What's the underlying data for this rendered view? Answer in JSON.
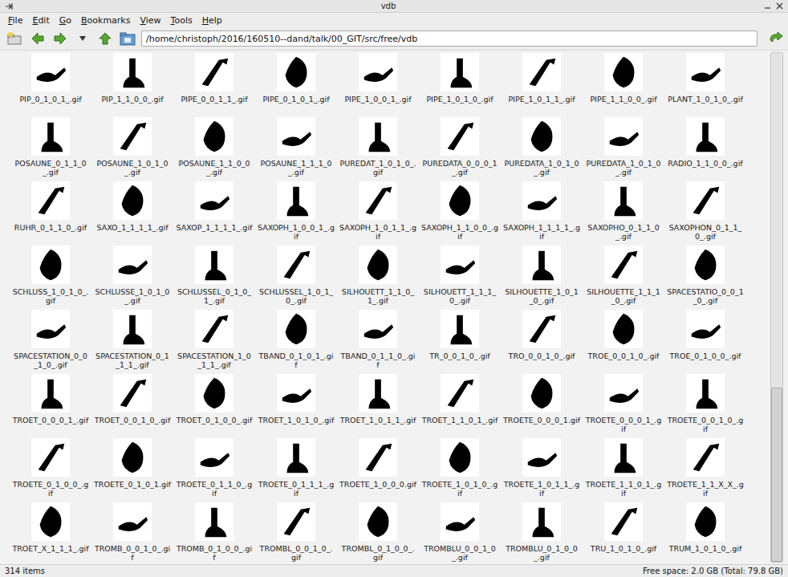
{
  "window": {
    "title": "vdb"
  },
  "menu": [
    "File",
    "Edit",
    "Go",
    "Bookmarks",
    "View",
    "Tools",
    "Help"
  ],
  "toolbar": {
    "path": "/home/christoph/2016/160510--dand/talk/00_GIT/src/free/vdb"
  },
  "files": [
    {
      "name": "PIP_0_1_0_1_.gif"
    },
    {
      "name": "PIP_1_1_0_0_.gif"
    },
    {
      "name": "PIPE_0_0_1_1_.gif"
    },
    {
      "name": "PIPE_0_1_0_1_.gif"
    },
    {
      "name": "PIPE_1_0_0_1_.gif"
    },
    {
      "name": "PIPE_1_0_1_0_.gif"
    },
    {
      "name": "PIPE_1_0_1_1_.gif"
    },
    {
      "name": "PIPE_1_1_0_0_.gif"
    },
    {
      "name": "PLANT_1_0_1_0_.gif"
    },
    {
      "name": "POSAUNE_0_1_1_0_.gif"
    },
    {
      "name": "POSAUNE_1_0_1_0_.gif"
    },
    {
      "name": "POSAUNE_1_1_0_0_.gif"
    },
    {
      "name": "POSAUNE_1_1_1_0_.gif"
    },
    {
      "name": "PUREDAT_1_0_1_0_.gif"
    },
    {
      "name": "PUREDATA_0_0_0_1_.gif"
    },
    {
      "name": "PUREDATA_1_0_1_0_.gif"
    },
    {
      "name": "PUREDATA_1_0_1_0_.gif"
    },
    {
      "name": "RADIO_1_1_0_0_.gif"
    },
    {
      "name": "RUHR_0_1_1_0_.gif"
    },
    {
      "name": "SAXO_1_1_1_1_.gif"
    },
    {
      "name": "SAXOP_1_1_1_1_.gif"
    },
    {
      "name": "SAXOPH_1_0_0_1_.gif"
    },
    {
      "name": "SAXOPH_1_0_1_1_.gif"
    },
    {
      "name": "SAXOPH_1_1_0_0_.gif"
    },
    {
      "name": "SAXOPH_1_1_1_1_.gif"
    },
    {
      "name": "SAXOPHO_0_1_1_0_.gif"
    },
    {
      "name": "SAXOPHON_0_1_1_0_.gif"
    },
    {
      "name": "SCHLUSS_1_0_1_0_.gif"
    },
    {
      "name": "SCHLUSSE_1_0_1_0_.gif"
    },
    {
      "name": "SCHLUSSEL_0_1_0_1_.gif"
    },
    {
      "name": "SCHLUSSEL_1_0_1_0_.gif"
    },
    {
      "name": "SILHOUETT_1_1_0_1_.gif"
    },
    {
      "name": "SILHOUETT_1_1_1_0_.gif"
    },
    {
      "name": "SILHOUETTE_1_0_1_0_.gif"
    },
    {
      "name": "SILHOUETTE_1_1_1_0_.gif"
    },
    {
      "name": "SPACESTATIO_0_0_1_0_.gif"
    },
    {
      "name": "SPACESTATION_0_0_1_0_.gif"
    },
    {
      "name": "SPACESTATION_0_1_1_1_.gif"
    },
    {
      "name": "SPACESTATION_1_0_1_1_.gif"
    },
    {
      "name": "TBAND_0_1_0_1_.gif"
    },
    {
      "name": "TBAND_0_1_1_0_.gif"
    },
    {
      "name": "TR_0_0_1_0_.gif"
    },
    {
      "name": "TRO_0_0_1_0_.gif"
    },
    {
      "name": "TROE_0_0_1_0_.gif"
    },
    {
      "name": "TROE_0_1_0_0_.gif"
    },
    {
      "name": "TROET_0_0_0_1_.gif"
    },
    {
      "name": "TROET_0_0_1_0_.gif"
    },
    {
      "name": "TROET_0_1_0_0_.gif"
    },
    {
      "name": "TROET_1_0_1_0_.gif"
    },
    {
      "name": "TROET_1_0_1_1_.gif"
    },
    {
      "name": "TROET_1_1_0_1_.gif"
    },
    {
      "name": "TROETE_0_0_0_1.gif"
    },
    {
      "name": "TROETE_0_0_0_1_.gif"
    },
    {
      "name": "TROETE_0_0_1_0_.gif"
    },
    {
      "name": "TROETE_0_1_0_0_.gif"
    },
    {
      "name": "TROETE_0_1_0_1.gif"
    },
    {
      "name": "TROETE_0_1_1_0_.gif"
    },
    {
      "name": "TROETE_0_1_1_1_.gif"
    },
    {
      "name": "TROETE_1_0_0_0.gif"
    },
    {
      "name": "TROETE_1_0_1_0_.gif"
    },
    {
      "name": "TROETE_1_0_1_1_.gif"
    },
    {
      "name": "TROETE_1_1_0_1_.gif"
    },
    {
      "name": "TROETE_1_1_X_X_.gif"
    },
    {
      "name": "TROET_X_1_1_1_.gif"
    },
    {
      "name": "TROMB_0_0_1_0_.gif"
    },
    {
      "name": "TROMB_0_1_0_0_.gif"
    },
    {
      "name": "TROMBL_0_0_1_0_.gif"
    },
    {
      "name": "TROMBL_0_1_0_0_.gif"
    },
    {
      "name": "TROMBLU_0_0_1_0_.gif"
    },
    {
      "name": "TROMBLU_0_1_0_0_.gif"
    },
    {
      "name": "TRU_1_0_1_0_.gif"
    },
    {
      "name": "TRUM_1_0_1_0_.gif"
    }
  ],
  "scrollbar": {
    "thumb_start": 0.66,
    "level": 0.34
  },
  "status_bar": {
    "items": "314 items",
    "free_space": "Free space: 2.0 GB (Total: 79.8 GB)"
  }
}
